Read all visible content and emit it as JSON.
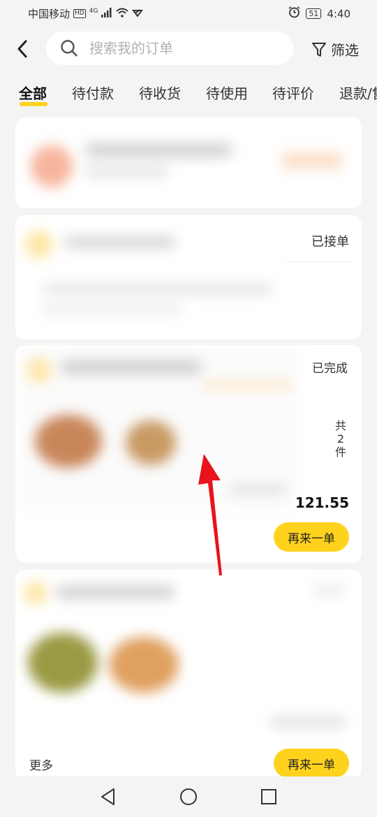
{
  "status_bar": {
    "carrier": "中国移动",
    "hd": "HD",
    "network": "4G",
    "battery": "51",
    "time": "4:40"
  },
  "header": {
    "search_placeholder": "搜索我的订单",
    "filter_label": "筛选"
  },
  "tabs": [
    {
      "label": "全部",
      "active": true
    },
    {
      "label": "待付款"
    },
    {
      "label": "待收货"
    },
    {
      "label": "待使用"
    },
    {
      "label": "待评价"
    },
    {
      "label": "退款/售后"
    }
  ],
  "orders": [
    {
      "status": ""
    },
    {
      "status": "已接单"
    },
    {
      "status": "已完成",
      "qty_prefix": "共",
      "qty_count": "2",
      "qty_suffix": "件",
      "price": "121.55",
      "reorder_label": "再来一单"
    },
    {
      "more_label": "更多",
      "reorder_label": "再来一单"
    }
  ],
  "colors": {
    "accent": "#ffd21e",
    "arrow": "#e8141c",
    "background": "#f4f4f4"
  },
  "icons": {
    "back": "chevron-left-icon",
    "search": "search-icon",
    "filter": "funnel-icon",
    "nav_back": "triangle-back-icon",
    "nav_home": "circle-home-icon",
    "nav_recents": "square-recents-icon"
  }
}
